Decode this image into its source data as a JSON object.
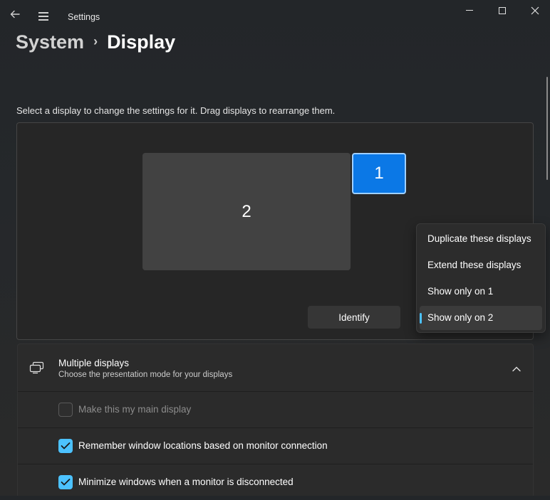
{
  "window": {
    "title": "Settings",
    "back_icon": "back-arrow-icon",
    "menu_icon": "hamburger-menu-icon"
  },
  "breadcrumb": {
    "parent": "System",
    "separator": "›",
    "current": "Display"
  },
  "instruction": "Select a display to change the settings for it. Drag displays to rearrange them.",
  "displays": {
    "monitor_1": "1",
    "monitor_2": "2",
    "selected": "1",
    "accent": "#0b78e6"
  },
  "identify_label": "Identify",
  "projection_menu": {
    "items": [
      "Duplicate these displays",
      "Extend these displays",
      "Show only on 1",
      "Show only on 2"
    ],
    "selected_index": 3,
    "indicator_color": "#4cc2ff"
  },
  "multiple_displays": {
    "title": "Multiple displays",
    "subtitle": "Choose the presentation mode for your displays",
    "expanded": true,
    "options": [
      {
        "label": "Make this my main display",
        "checked": false,
        "disabled": true
      },
      {
        "label": "Remember window locations based on monitor connection",
        "checked": true,
        "disabled": false
      },
      {
        "label": "Minimize windows when a monitor is disconnected",
        "checked": true,
        "disabled": false
      }
    ]
  }
}
